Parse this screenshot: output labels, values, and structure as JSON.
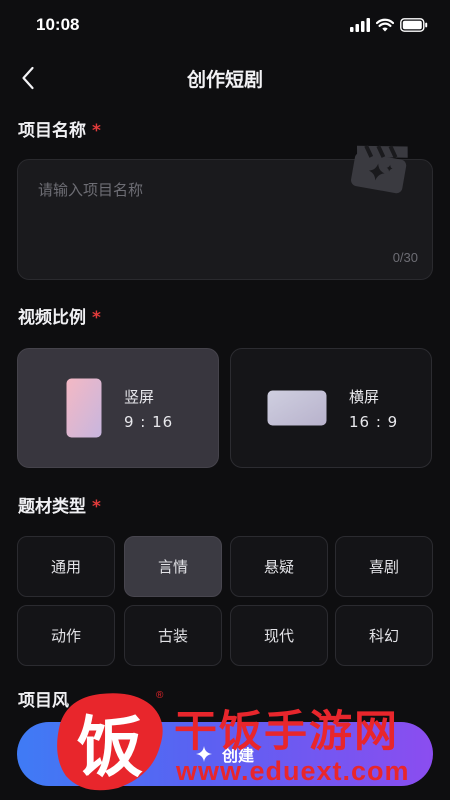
{
  "status_bar": {
    "time": "10:08"
  },
  "nav": {
    "title": "创作短剧"
  },
  "project_name": {
    "label": "项目名称",
    "required_mark": "*",
    "placeholder": "请输入项目名称",
    "value": "",
    "counter": "0/30"
  },
  "aspect_ratio": {
    "label": "视频比例",
    "required_mark": "*",
    "options": [
      {
        "name": "竖屏",
        "ratio": "9 : 16",
        "selected": true
      },
      {
        "name": "横屏",
        "ratio": "16 : 9",
        "selected": false
      }
    ]
  },
  "genre": {
    "label": "题材类型",
    "required_mark": "*",
    "tags": [
      "通用",
      "言情",
      "悬疑",
      "喜剧",
      "动作",
      "古装",
      "现代",
      "科幻"
    ],
    "selected": "言情"
  },
  "style": {
    "label": "项目风"
  },
  "create_button": {
    "label": "创建"
  },
  "watermark": {
    "cn": "干饭手游网",
    "url": "www.eduext.com",
    "logo_char": "饭"
  },
  "colors": {
    "background": "#0e0e10",
    "required": "#e23b3b",
    "button_gradient_start": "#3f7bf5",
    "button_gradient_end": "#8b4df0",
    "watermark": "#e8262c"
  },
  "icons": [
    "back-icon",
    "signal-icon",
    "wifi-icon",
    "battery-icon",
    "clapperboard-icon",
    "sparkle-icon"
  ]
}
